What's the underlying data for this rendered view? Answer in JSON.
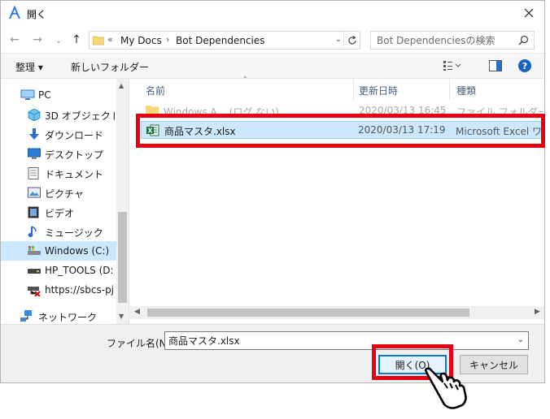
{
  "window": {
    "title": "開く"
  },
  "navigation": {
    "back": "←",
    "forward": "→",
    "recent": "⌄",
    "up": "↑"
  },
  "address": {
    "overflow": "«",
    "crumbs": [
      "My Docs",
      "Bot Dependencies"
    ],
    "separator": "›"
  },
  "search": {
    "placeholder": "Bot Dependenciesの検索"
  },
  "toolbar": {
    "organize": "整理 ▾",
    "new_folder": "新しいフォルダー"
  },
  "sidebar": {
    "items": [
      {
        "label": "PC",
        "icon": "pc-icon"
      },
      {
        "label": "3D オブジェクト",
        "icon": "3d-objects-icon"
      },
      {
        "label": "ダウンロード",
        "icon": "download-icon"
      },
      {
        "label": "デスクトップ",
        "icon": "desktop-icon"
      },
      {
        "label": "ドキュメント",
        "icon": "documents-icon"
      },
      {
        "label": "ピクチャ",
        "icon": "pictures-icon"
      },
      {
        "label": "ビデオ",
        "icon": "video-icon"
      },
      {
        "label": "ミュージック",
        "icon": "music-icon"
      },
      {
        "label": "Windows (C:)",
        "icon": "drive-icon"
      },
      {
        "label": "HP_TOOLS (D:)",
        "icon": "drive-icon"
      },
      {
        "label": "https://sbcs-pj.b",
        "icon": "network-drive-icon"
      },
      {
        "label": "ネットワーク",
        "icon": "network-icon"
      }
    ]
  },
  "columns": {
    "name": "名前",
    "date": "更新日時",
    "type": "種類"
  },
  "files": [
    {
      "name": "Windows A... (ログ ない)",
      "date": "2020/03/13 16:45",
      "type": "ファイル フォルダー"
    },
    {
      "name": "商品マスタ.xlsx",
      "date": "2020/03/13 17:19",
      "type": "Microsoft Excel ワ..."
    }
  ],
  "footer": {
    "filename_label": "ファイル名(N):",
    "filename_value": "商品マスタ.xlsx",
    "open_label": "開く(O)",
    "cancel_label": "キャンセル"
  },
  "colors": {
    "highlight": "#e60012",
    "selection": "#cce8ff",
    "accent": "#0078d7"
  }
}
